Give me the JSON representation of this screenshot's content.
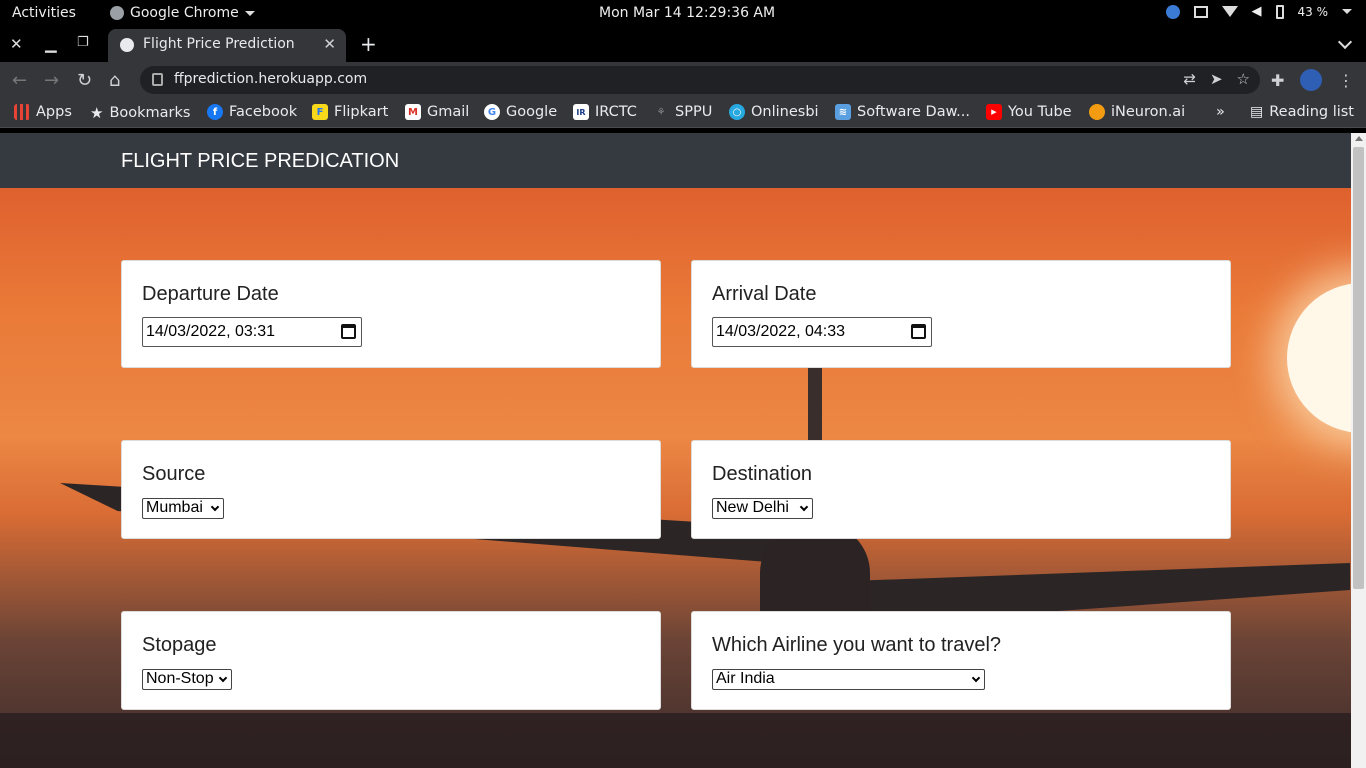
{
  "system": {
    "activities": "Activities",
    "app_menu": "Google Chrome",
    "clock": "Mon Mar 14  12:29:36 AM",
    "battery": "43 %"
  },
  "browser": {
    "tab_title": "Flight Price Prediction",
    "url": "ffprediction.herokuapp.com",
    "bookmarks": [
      {
        "label": "Apps",
        "icon": "apps-grid-icon"
      },
      {
        "label": "Bookmarks",
        "icon": "star-icon"
      },
      {
        "label": "Facebook",
        "icon": "facebook-icon"
      },
      {
        "label": "Flipkart",
        "icon": "flipkart-icon"
      },
      {
        "label": "Gmail",
        "icon": "gmail-icon"
      },
      {
        "label": "Google",
        "icon": "google-icon"
      },
      {
        "label": "IRCTC",
        "icon": "irctc-icon"
      },
      {
        "label": "SPPU",
        "icon": "sppu-icon"
      },
      {
        "label": "Onlinesbi",
        "icon": "onlinesbi-icon"
      },
      {
        "label": "Software Daw...",
        "icon": "software-icon"
      },
      {
        "label": "You Tube",
        "icon": "youtube-icon"
      },
      {
        "label": "iNeuron.ai",
        "icon": "ineuron-icon"
      }
    ],
    "reading_list": "Reading list",
    "more_bookmarks": "»"
  },
  "page": {
    "brand": "FLIGHT PRICE PREDICATION",
    "departure": {
      "label": "Departure Date",
      "value": "14/03/2022, 03:31"
    },
    "arrival": {
      "label": "Arrival Date",
      "value": "14/03/2022, 04:33"
    },
    "source": {
      "label": "Source",
      "value": "Mumbai"
    },
    "destination": {
      "label": "Destination",
      "value": "New Delhi"
    },
    "stopage": {
      "label": "Stopage",
      "value": "Non-Stop"
    },
    "airline": {
      "label": "Which Airline you want to travel?",
      "value": "Air India"
    }
  },
  "colors": {
    "navbar": "#343a40",
    "sky_top": "#d9552a",
    "sky_mid": "#ec8744"
  }
}
